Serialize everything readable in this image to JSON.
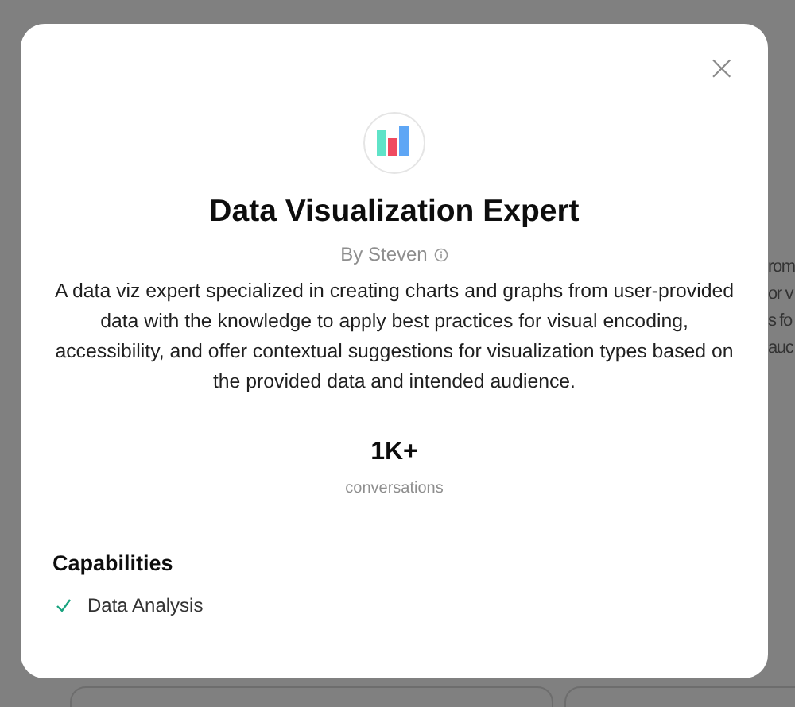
{
  "background": {
    "text_fragments": [
      "rom",
      "or v",
      "s fo",
      "auc"
    ]
  },
  "dialog": {
    "close_label": "×",
    "title": "Data Visualization Expert",
    "author": "By Steven",
    "description": "A data viz expert specialized in creating charts and graphs from user-provided data with the knowledge to apply best practices for visual encoding, accessibility, and offer contextual suggestions for visualization types based on the provided data and intended audience.",
    "stat": {
      "value": "1K+",
      "label": "conversations"
    },
    "capabilities_title": "Capabilities",
    "capabilities": [
      {
        "label": "Data Analysis",
        "checked": true
      }
    ]
  }
}
